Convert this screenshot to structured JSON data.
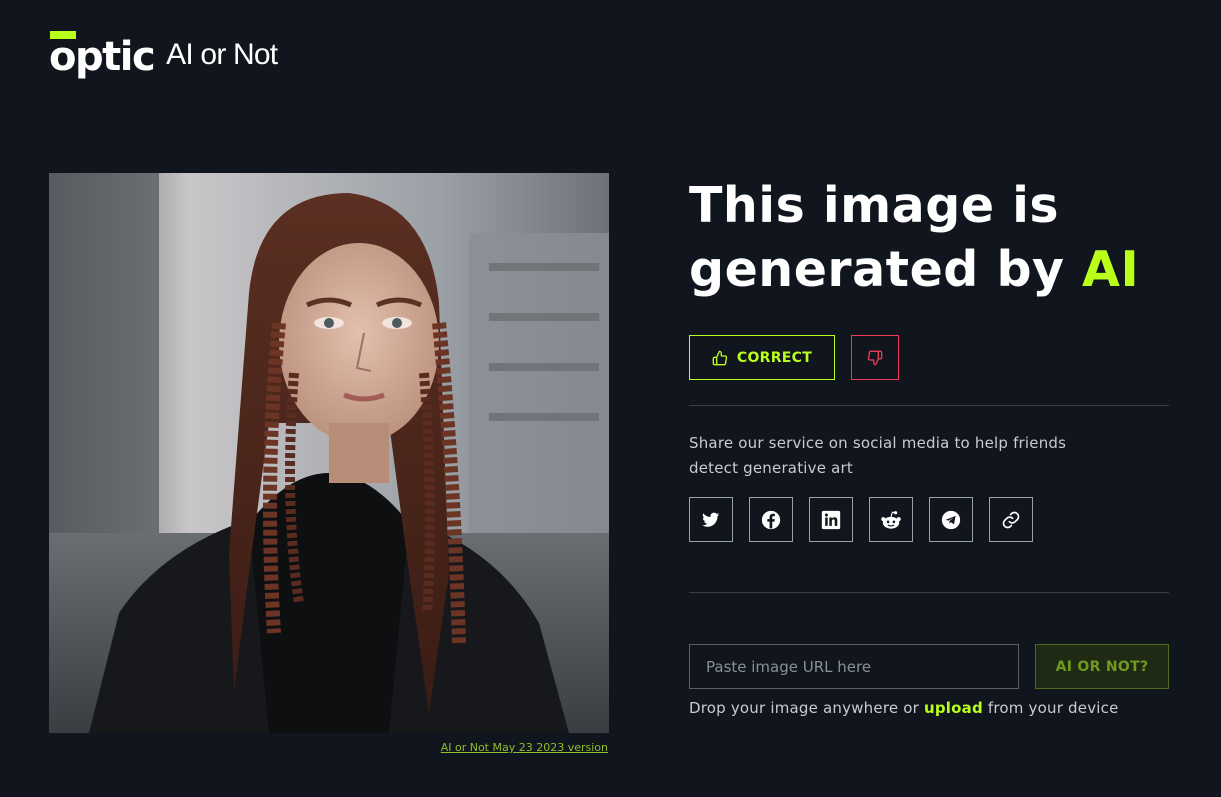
{
  "brand": {
    "logo_text": "optic",
    "product_name": "AI or Not",
    "accent_color": "#b9ff1a"
  },
  "image_panel": {
    "alt": "Uploaded image",
    "version_link": "AI or Not May 23 2023 version"
  },
  "result": {
    "headline_part1": "This image is",
    "headline_part2": "generated by ",
    "headline_accent": "AI"
  },
  "feedback": {
    "correct_label": "CORRECT",
    "correct_icon": "thumbs-up-icon",
    "wrong_icon": "thumbs-down-icon",
    "correct_color": "#b9ff1a",
    "wrong_color": "#ef3b5a"
  },
  "share": {
    "text": "Share our service on social media to help friends detect generative art",
    "buttons": [
      {
        "name": "twitter",
        "icon": "twitter-icon"
      },
      {
        "name": "facebook",
        "icon": "facebook-icon"
      },
      {
        "name": "linkedin",
        "icon": "linkedin-icon"
      },
      {
        "name": "reddit",
        "icon": "reddit-icon"
      },
      {
        "name": "telegram",
        "icon": "telegram-icon"
      },
      {
        "name": "copy-link",
        "icon": "link-icon"
      }
    ]
  },
  "check": {
    "url_placeholder": "Paste image URL here",
    "url_value": "",
    "button_label": "AI OR NOT?",
    "drop_prefix": "Drop your image anywhere or ",
    "drop_link": "upload",
    "drop_suffix": " from your device"
  }
}
